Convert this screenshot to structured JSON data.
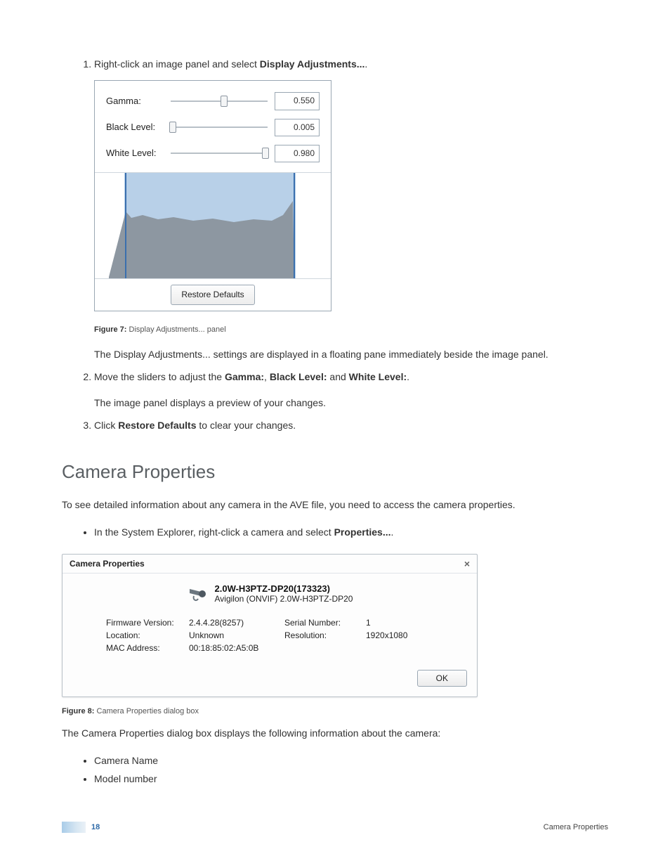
{
  "step1": {
    "text_before": "Right-click an image panel and select ",
    "bold": "Display Adjustments...",
    "text_after": "."
  },
  "display_adjustments": {
    "gamma": {
      "label": "Gamma:",
      "value": "0.550",
      "pos": 55
    },
    "black": {
      "label": "Black Level:",
      "value": "0.005",
      "pos": 2
    },
    "white": {
      "label": "White Level:",
      "value": "0.980",
      "pos": 98
    },
    "restore_button": "Restore Defaults"
  },
  "figure7": {
    "label": "Figure 7:",
    "text": " Display Adjustments... panel"
  },
  "step1_subtext": "The Display Adjustments... settings are displayed in a floating pane immediately beside the image panel.",
  "step2": {
    "text_a": "Move the sliders to adjust the ",
    "b1": "Gamma:",
    "sep1": ", ",
    "b2": "Black Level:",
    "sep2": " and ",
    "b3": "White Level:",
    "suffix": ".",
    "subtext": "The image panel displays a preview of your changes."
  },
  "step3": {
    "text_a": "Click ",
    "b": "Restore Defaults",
    "text_b": " to clear your changes."
  },
  "section_title": "Camera Properties",
  "section_intro": "To see detailed information about any camera in the AVE file, you need to access the camera properties.",
  "bullet_properties": {
    "text_a": "In the System Explorer, right-click a camera and select ",
    "b": "Properties...",
    "text_b": "."
  },
  "camera_properties": {
    "title": "Camera Properties",
    "close": "×",
    "name": "2.0W-H3PTZ-DP20(173323)",
    "model": "Avigilon (ONVIF) 2.0W-H3PTZ-DP20",
    "fields": {
      "firmware_label": "Firmware Version:",
      "firmware_value": "2.4.4.28(8257)",
      "location_label": "Location:",
      "location_value": "Unknown",
      "mac_label": "MAC Address:",
      "mac_value": "00:18:85:02:A5:0B",
      "serial_label": "Serial Number:",
      "serial_value": "1",
      "resolution_label": "Resolution:",
      "resolution_value": "1920x1080"
    },
    "ok_button": "OK"
  },
  "figure8": {
    "label": "Figure 8:",
    "text": " Camera Properties dialog box"
  },
  "after_dialog_text": "The Camera Properties dialog box displays the following information about the camera:",
  "info_list": {
    "item1": "Camera Name",
    "item2": "Model number"
  },
  "footer": {
    "page_number": "18",
    "section": "Camera Properties"
  }
}
